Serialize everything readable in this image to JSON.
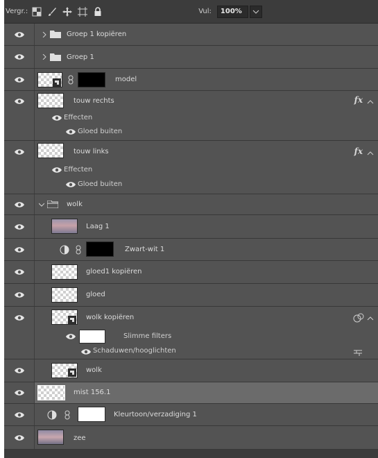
{
  "toolbar": {
    "lock_label": "Vergr.:",
    "fill_label": "Vul:",
    "fill_value": "100%",
    "icons": [
      "lock-transparent-icon",
      "brush-icon",
      "move-icon",
      "artboard-icon",
      "lock-all-icon"
    ]
  },
  "layers": [
    {
      "name": "Groep 1 kopiëren",
      "type": "group-collapsed"
    },
    {
      "name": "Groep 1",
      "type": "group-collapsed"
    },
    {
      "name": "model",
      "type": "smart-object-with-mask"
    },
    {
      "name": "touw rechts",
      "type": "layer-fx",
      "effects_label": "Effecten",
      "effect": "Gloed buiten"
    },
    {
      "name": "touw links",
      "type": "layer-fx",
      "effects_label": "Effecten",
      "effect": "Gloed buiten"
    },
    {
      "name": "wolk",
      "type": "group-open"
    },
    {
      "name": "Laag 1",
      "type": "image"
    },
    {
      "name": "Zwart-wit 1",
      "type": "adjustment"
    },
    {
      "name": "gloed1 kopiëren",
      "type": "transparent"
    },
    {
      "name": "gloed",
      "type": "transparent"
    },
    {
      "name": "wolk kopiëren",
      "type": "smart-filters",
      "filters_label": "Slimme filters",
      "filter": "Schaduwen/hooglichten"
    },
    {
      "name": "wolk",
      "type": "smart-object"
    },
    {
      "name": "mist 156.1",
      "type": "selected"
    },
    {
      "name": "Kleurtoon/verzadiging 1",
      "type": "adjustment"
    },
    {
      "name": "zee",
      "type": "image"
    }
  ],
  "fx_symbol": "fx"
}
